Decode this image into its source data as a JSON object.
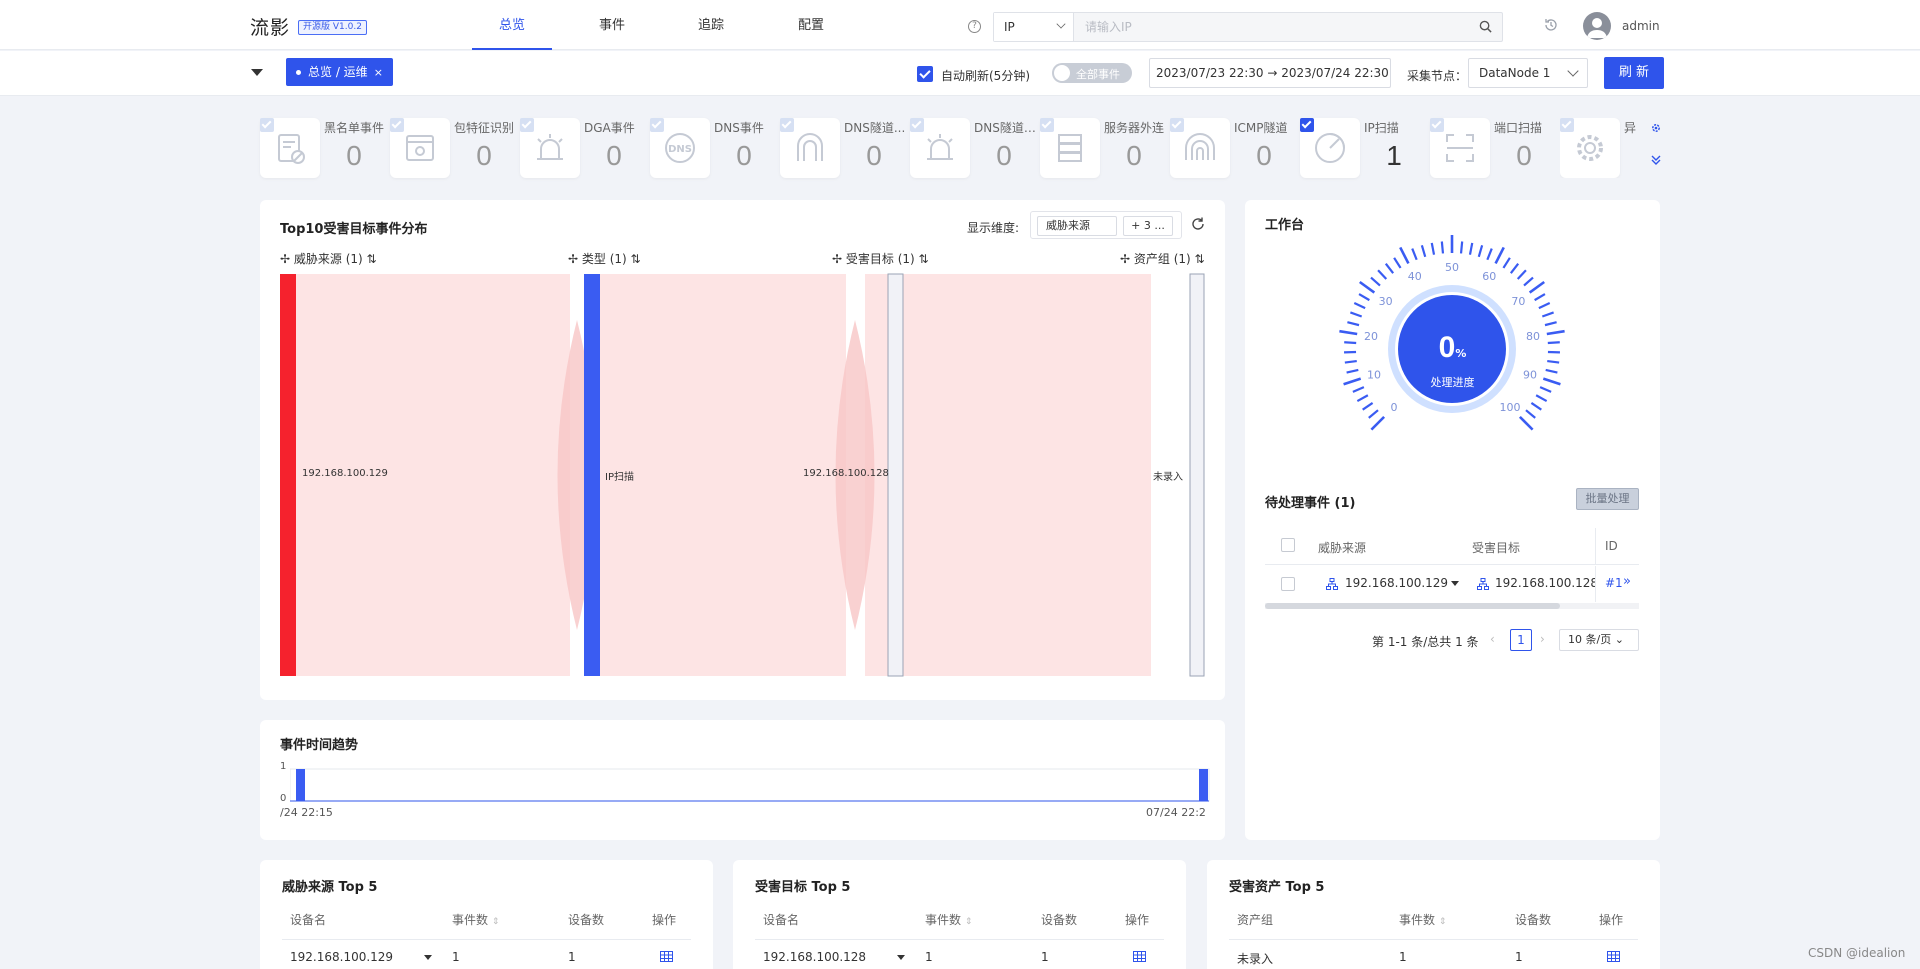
{
  "header": {
    "logo": "流影",
    "version": "开源版 V1.0.2",
    "nav": [
      "总览",
      "事件",
      "追踪",
      "配置"
    ],
    "active_nav": "总览",
    "search": {
      "type": "IP",
      "placeholder": "请输入IP"
    },
    "user": "admin"
  },
  "toolbar": {
    "tab_label": "总览 / 运维",
    "tab_close": "×",
    "auto_refresh_label": "自动刷新(5分钟)",
    "auto_refresh_checked": true,
    "toggle_label": "全部事件",
    "date_range": "2023/07/23 22:30 → 2023/07/24 22:30",
    "node_label": "采集节点：",
    "node_value": "DataNode 1",
    "refresh_label": "刷 新"
  },
  "stats": [
    {
      "name": "黑名单事件",
      "count": "0",
      "checked": false,
      "icon": "blacklist-icon"
    },
    {
      "name": "包特征识别",
      "count": "0",
      "checked": false,
      "icon": "packet-feature-icon"
    },
    {
      "name": "DGA事件",
      "count": "0",
      "checked": false,
      "icon": "alarm-icon"
    },
    {
      "name": "DNS事件",
      "count": "0",
      "checked": false,
      "icon": "dns-icon"
    },
    {
      "name": "DNS隧道...",
      "count": "0",
      "checked": false,
      "icon": "tunnel-icon"
    },
    {
      "name": "DNS隧道A...",
      "count": "0",
      "checked": false,
      "icon": "alarm-icon"
    },
    {
      "name": "服务器外连",
      "count": "0",
      "checked": false,
      "icon": "server-icon"
    },
    {
      "name": "ICMP隧道",
      "count": "0",
      "checked": false,
      "icon": "icmp-tunnel-icon"
    },
    {
      "name": "IP扫描",
      "count": "1",
      "checked": true,
      "icon": "ip-scan-icon"
    },
    {
      "name": "端口扫描",
      "count": "0",
      "checked": false,
      "icon": "port-scan-icon"
    },
    {
      "name": "异",
      "count": "",
      "checked": false,
      "icon": "gear-icon"
    }
  ],
  "sankey": {
    "title": "Top10受害目标事件分布",
    "dim_label": "显示维度:",
    "dim_tag": "威胁来源",
    "dim_more": "+ 3 ...",
    "columns": [
      "威胁来源 (1)",
      "类型 (1)",
      "受害目标 (1)",
      "资产组 (1)"
    ],
    "nodes": [
      "192.168.100.129",
      "IP扫描",
      "192.168.100.128",
      "未录入"
    ],
    "colors": {
      "source": "#f5222d",
      "type": "#3a5cf2",
      "flow": "#fde4e4"
    }
  },
  "trend": {
    "title": "事件时间趋势",
    "y_ticks": [
      "1",
      "0"
    ],
    "x_start": "/24 22:15",
    "x_end": "07/24 22:2"
  },
  "chart_data": {
    "type": "bar",
    "title": "事件时间趋势",
    "x": [
      "/24 22:15",
      "07/24 22:2"
    ],
    "values": [
      1,
      1
    ],
    "ylim": [
      0,
      1
    ]
  },
  "workbench": {
    "title": "工作台",
    "gauge_value": "0",
    "gauge_unit": "%",
    "gauge_label": "处理进度",
    "progress": 0,
    "gauge_ticks": [
      "0",
      "10",
      "20",
      "30",
      "40",
      "50",
      "60",
      "70",
      "80",
      "90",
      "100"
    ],
    "pending_title": "待处理事件 (1)",
    "batch_label": "批量处理",
    "table_headers": [
      "威胁来源",
      "受害目标",
      "ID"
    ],
    "rows": [
      {
        "source": "192.168.100.129",
        "target": "192.168.100.128",
        "id": "#1"
      }
    ],
    "pagination": {
      "summary": "第 1-1 条/总共 1 条",
      "page": "1",
      "size": "10 条/页"
    }
  },
  "bottom": [
    {
      "title": "威胁来源 Top 5",
      "headers": [
        "设备名",
        "事件数",
        "设备数",
        "操作"
      ],
      "row": [
        "192.168.100.129",
        "1",
        "1"
      ]
    },
    {
      "title": "受害目标 Top 5",
      "headers": [
        "设备名",
        "事件数",
        "设备数",
        "操作"
      ],
      "row": [
        "192.168.100.128",
        "1",
        "1"
      ]
    },
    {
      "title": "受害资产 Top 5",
      "headers": [
        "资产组",
        "事件数",
        "设备数",
        "操作"
      ],
      "row": [
        "未录入",
        "1",
        "1"
      ]
    }
  ],
  "watermark": "CSDN @idealion"
}
